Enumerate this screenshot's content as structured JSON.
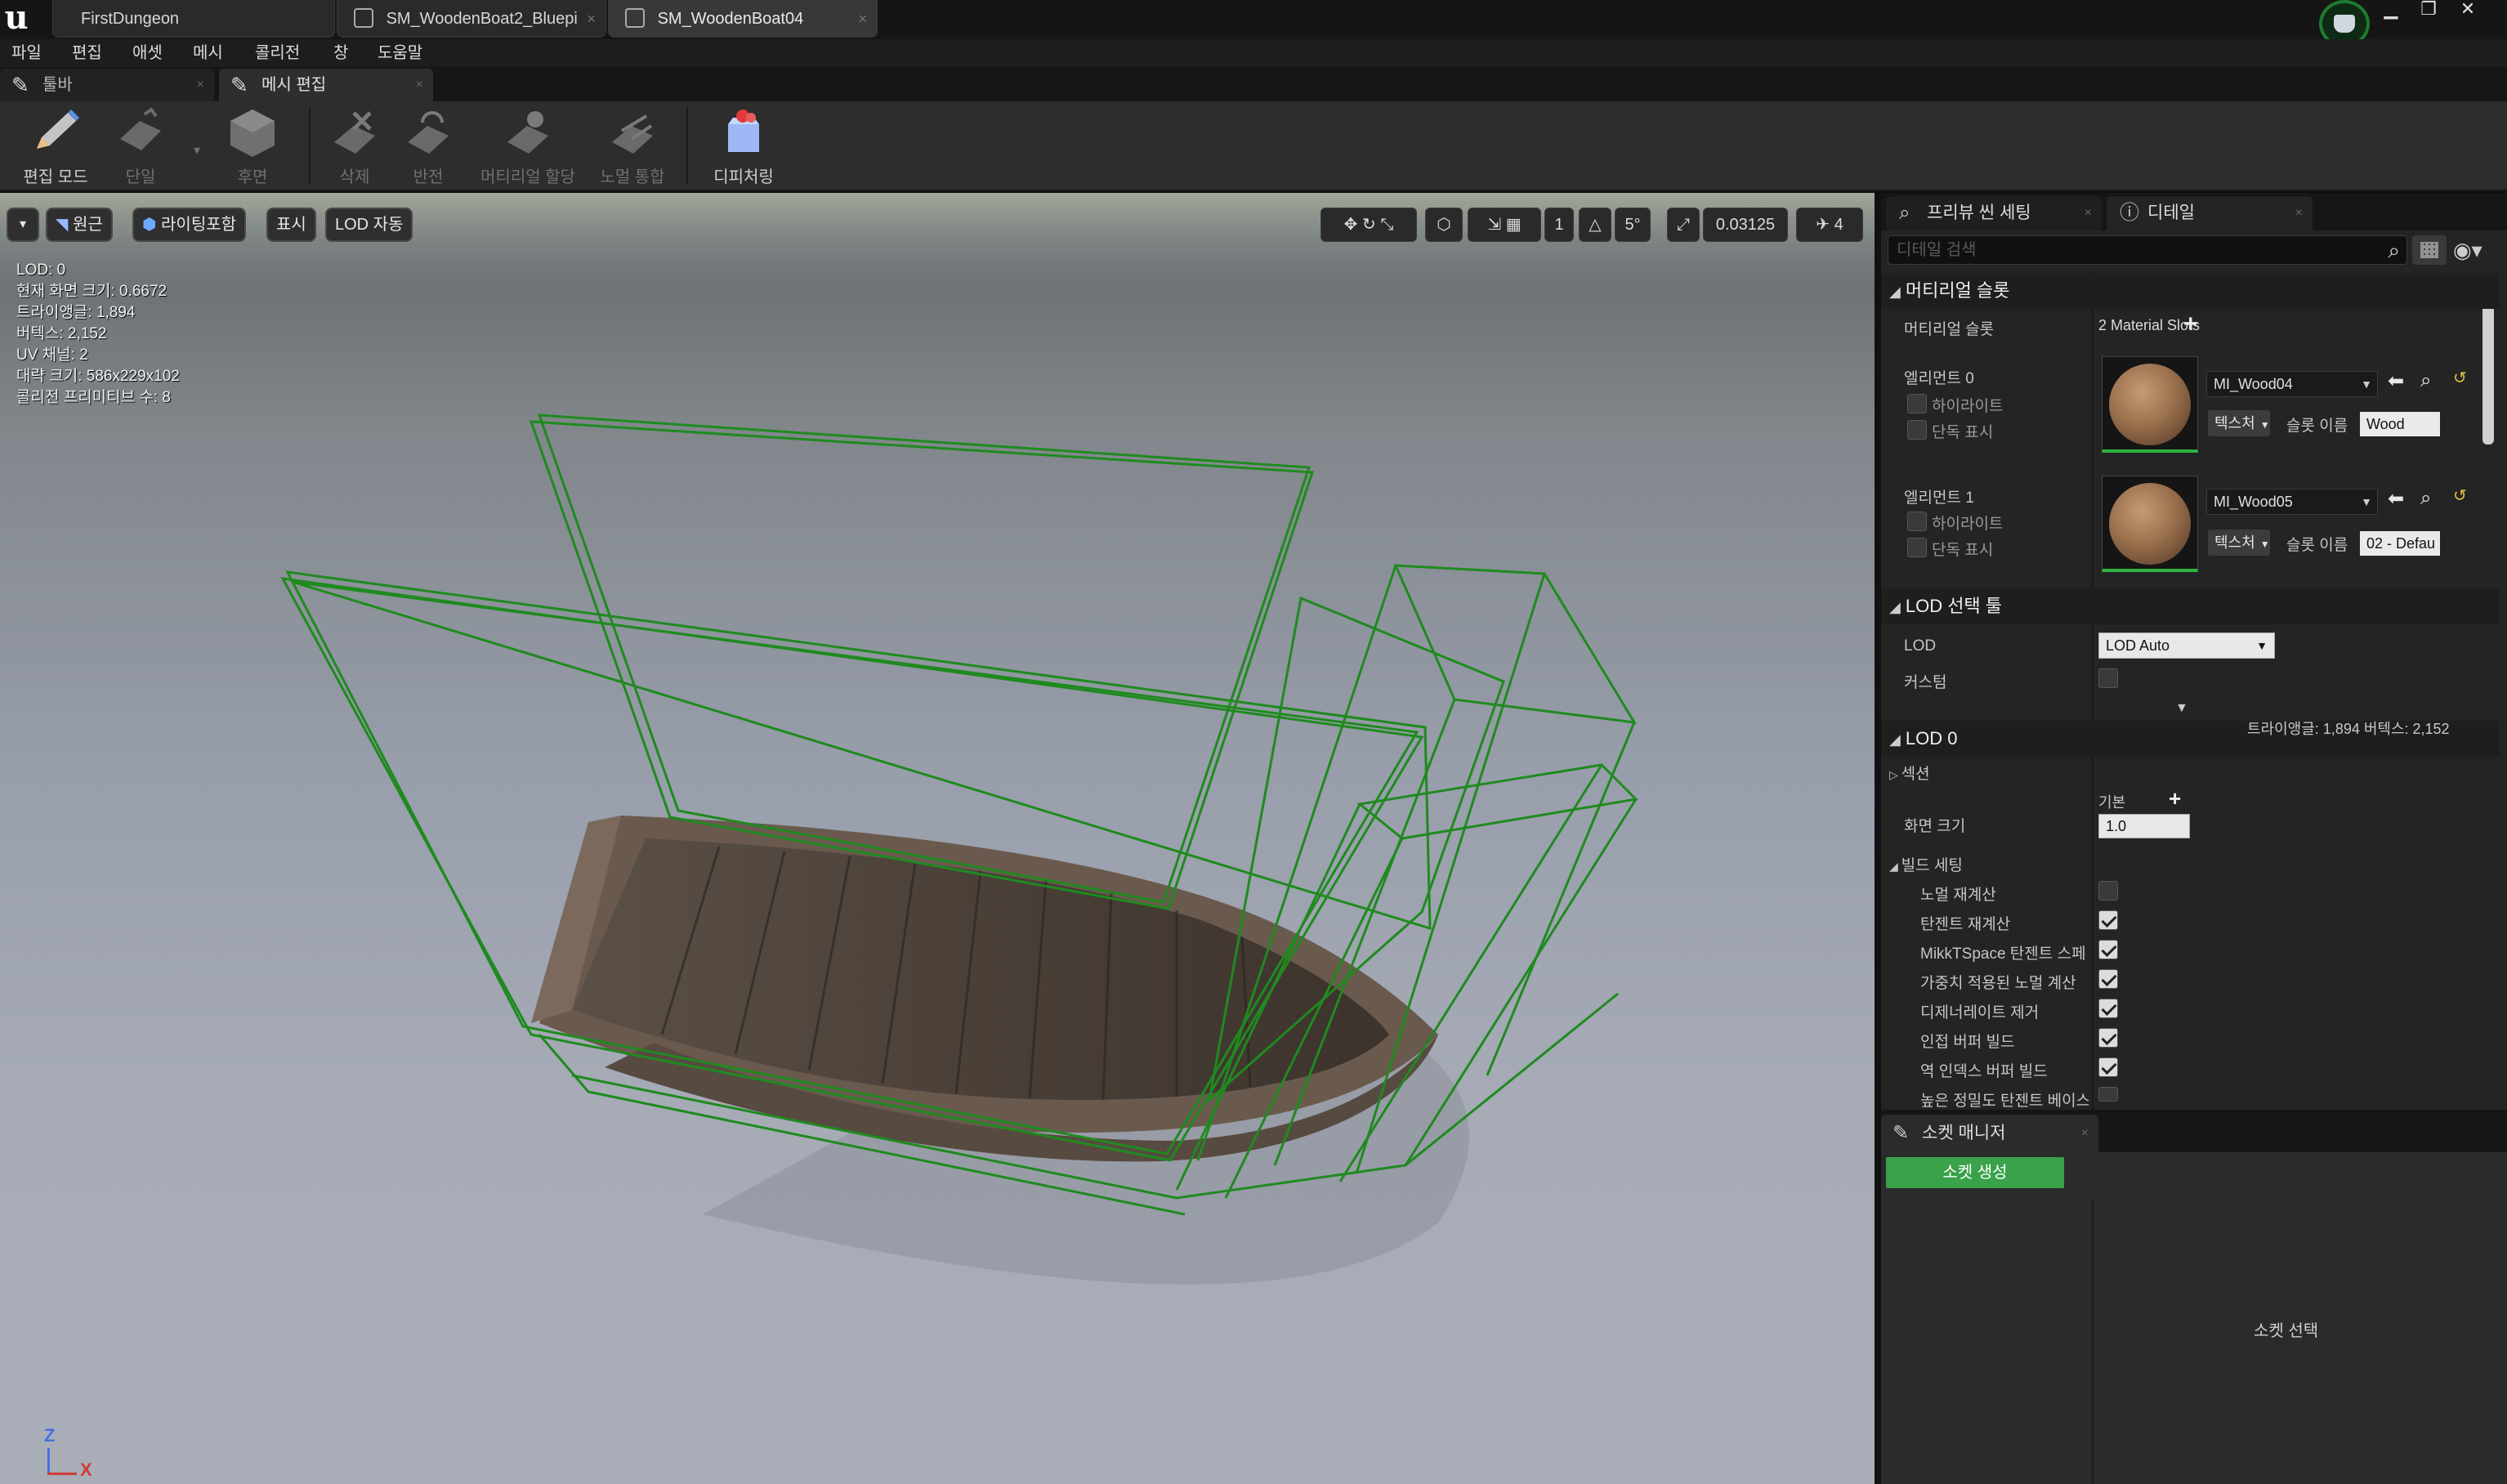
{
  "window": {
    "logo": "u",
    "tabs": [
      "FirstDungeon",
      "SM_WoodenBoat2_Bluepi",
      "SM_WoodenBoat04"
    ],
    "controls": [
      "▁",
      "❐",
      "✕"
    ]
  },
  "menu": [
    "파일",
    "편집",
    "애셋",
    "메시",
    "콜리전",
    "창",
    "도움말"
  ],
  "panel_tabs": [
    "툴바",
    "메시 편집"
  ],
  "toolbar": {
    "buttons": [
      {
        "label": "편집 모드",
        "icon": "pencil-icon"
      },
      {
        "label": "단일",
        "icon": "single-plane-icon"
      },
      {
        "label": "후면",
        "icon": "cube-icon"
      },
      {
        "label": "삭제",
        "icon": "delete-icon"
      },
      {
        "label": "반전",
        "icon": "flip-icon"
      },
      {
        "label": "머티리얼 할당",
        "icon": "material-assign-icon"
      },
      {
        "label": "노멀 통합",
        "icon": "normal-icon"
      },
      {
        "label": "디피처링",
        "icon": "defeature-icon"
      }
    ]
  },
  "viewport": {
    "buttons": [
      "원근",
      "라이팅포함",
      "표시",
      "LOD 자동"
    ],
    "grid_snap": "5°",
    "scale_snap": "0.03125",
    "camera_speed": "4",
    "stats": [
      "LOD:  0",
      "현재 화면 크기: 0.6672",
      "트라이앵글: 1,894",
      "버텍스: 2,152",
      "UV 채널:  2",
      "대략 크기: 586x229x102",
      "콜리전 프리미티브 수: 8"
    ],
    "axis": {
      "z": "Z",
      "x": "X"
    }
  },
  "details": {
    "tabs": [
      "프리뷰 씬 세팅",
      "디테일"
    ],
    "search_placeholder": "디테일 검색",
    "material_slots": {
      "header": "머티리얼 슬롯",
      "label": "머티리얼 슬롯",
      "count": "2 Material Slots",
      "elements": [
        {
          "title": "엘리먼트 0",
          "highlight": "하이라이트",
          "isolate": "단독 표시",
          "material": "MI_Wood04",
          "texture_btn": "텍스처",
          "slot_label": "슬롯 이름",
          "slot_name": "Wood"
        },
        {
          "title": "엘리먼트 1",
          "highlight": "하이라이트",
          "isolate": "단독 표시",
          "material": "MI_Wood05",
          "texture_btn": "텍스처",
          "slot_label": "슬롯 이름",
          "slot_name": "02 - Defau"
        }
      ]
    },
    "lod_picker": {
      "header": "LOD 선택 툴",
      "lod_label": "LOD",
      "lod_value": "LOD Auto",
      "custom_label": "커스텀"
    },
    "lod0": {
      "header": "LOD 0",
      "tri_info": "트라이앵글: 1,894    버텍스: 2,152",
      "sections": "섹션",
      "screen_size_label": "화면 크기",
      "screen_size_default": "기본",
      "screen_size_value": "1.0",
      "build_settings": "빌드 세팅",
      "build_options": [
        {
          "label": "노멀 재계산",
          "checked": false
        },
        {
          "label": "탄젠트 재계산",
          "checked": true
        },
        {
          "label": "MikkTSpace 탄젠트 스페",
          "checked": true
        },
        {
          "label": "가중치 적용된 노멀 계산",
          "checked": true
        },
        {
          "label": "디제너레이트 제거",
          "checked": true
        },
        {
          "label": "인접 버퍼 빌드",
          "checked": true
        },
        {
          "label": "역 인덱스 버퍼 빌드",
          "checked": true
        },
        {
          "label": "높은 정밀도 탄젠트 베이스",
          "checked": false
        }
      ]
    },
    "socket_manager": {
      "tab": "소켓 매니저",
      "create_button": "소켓 생성",
      "select_hint": "소켓 선택"
    }
  },
  "colors": {
    "accent_green": "#3aa24a",
    "collision_green": "#1f8a1f",
    "panel_bg": "#242424"
  }
}
